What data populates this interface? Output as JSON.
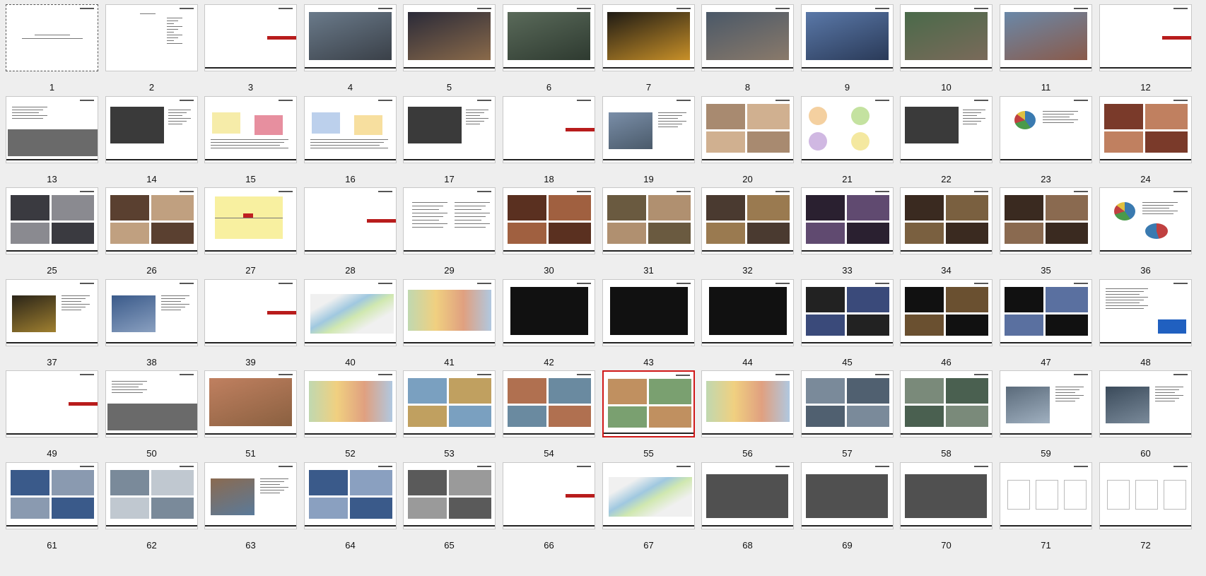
{
  "window": {
    "title": ""
  },
  "colors": {
    "background": "#eeeeee",
    "selection": "#d01818",
    "accent_red": "#b81c1c"
  },
  "selected_slide": 55,
  "slides": [
    {
      "n": "1",
      "kind": "title"
    },
    {
      "n": "2",
      "kind": "toc"
    },
    {
      "n": "3",
      "kind": "section"
    },
    {
      "n": "4",
      "kind": "photo",
      "colors": [
        "#6a7a8a",
        "#3a4048"
      ]
    },
    {
      "n": "5",
      "kind": "photo",
      "colors": [
        "#2a2a38",
        "#8a6a4a"
      ]
    },
    {
      "n": "6",
      "kind": "photo",
      "colors": [
        "#5a6a5a",
        "#2e3a30"
      ]
    },
    {
      "n": "7",
      "kind": "photo",
      "colors": [
        "#1e1a14",
        "#c89028"
      ]
    },
    {
      "n": "8",
      "kind": "photo",
      "colors": [
        "#4a5868",
        "#8a7a6a"
      ]
    },
    {
      "n": "9",
      "kind": "photo",
      "colors": [
        "#5a78a8",
        "#2a3a58"
      ]
    },
    {
      "n": "10",
      "kind": "photo",
      "colors": [
        "#4a6a4a",
        "#7a6a5a"
      ]
    },
    {
      "n": "11",
      "kind": "photo",
      "colors": [
        "#6a88a8",
        "#8a5a4a"
      ]
    },
    {
      "n": "12",
      "kind": "section"
    },
    {
      "n": "13",
      "kind": "map"
    },
    {
      "n": "14",
      "kind": "darkmap"
    },
    {
      "n": "15",
      "kind": "diagram",
      "colors": [
        "#d02040",
        "#f0e070"
      ]
    },
    {
      "n": "16",
      "kind": "diagram",
      "colors": [
        "#f0c040",
        "#90b0e0"
      ]
    },
    {
      "n": "17",
      "kind": "darkmap"
    },
    {
      "n": "18",
      "kind": "section"
    },
    {
      "n": "19",
      "kind": "photo-text",
      "colors": [
        "#7a8ea8",
        "#4a5a6a"
      ]
    },
    {
      "n": "20",
      "kind": "collage",
      "colors": [
        "#a88a70",
        "#d0b090"
      ]
    },
    {
      "n": "21",
      "kind": "circles"
    },
    {
      "n": "22",
      "kind": "darkmap"
    },
    {
      "n": "23",
      "kind": "pie"
    },
    {
      "n": "24",
      "kind": "collage",
      "colors": [
        "#7a3a2a",
        "#c08060"
      ]
    },
    {
      "n": "25",
      "kind": "collage",
      "colors": [
        "#3a3a40",
        "#8a8a90"
      ]
    },
    {
      "n": "26",
      "kind": "collage",
      "colors": [
        "#5a4030",
        "#c0a080"
      ]
    },
    {
      "n": "27",
      "kind": "quadrant"
    },
    {
      "n": "28",
      "kind": "section"
    },
    {
      "n": "29",
      "kind": "text"
    },
    {
      "n": "30",
      "kind": "collage",
      "colors": [
        "#5a3020",
        "#a06040"
      ]
    },
    {
      "n": "31",
      "kind": "collage",
      "colors": [
        "#6a5a40",
        "#b09070"
      ]
    },
    {
      "n": "32",
      "kind": "collage",
      "colors": [
        "#4a3a30",
        "#9a7a50"
      ]
    },
    {
      "n": "33",
      "kind": "collage",
      "colors": [
        "#2a2030",
        "#604a70"
      ]
    },
    {
      "n": "34",
      "kind": "collage",
      "colors": [
        "#3a2a20",
        "#7a6040"
      ]
    },
    {
      "n": "35",
      "kind": "collage",
      "colors": [
        "#3a2a20",
        "#8a6a50"
      ]
    },
    {
      "n": "36",
      "kind": "pie2"
    },
    {
      "n": "37",
      "kind": "photo-text",
      "colors": [
        "#2a2418",
        "#a08030"
      ]
    },
    {
      "n": "38",
      "kind": "photo-text",
      "colors": [
        "#3a5a8a",
        "#8aa0c0"
      ]
    },
    {
      "n": "39",
      "kind": "section"
    },
    {
      "n": "40",
      "kind": "river"
    },
    {
      "n": "41",
      "kind": "plan"
    },
    {
      "n": "42",
      "kind": "blackplan"
    },
    {
      "n": "43",
      "kind": "blackplan"
    },
    {
      "n": "44",
      "kind": "blackplan"
    },
    {
      "n": "45",
      "kind": "collage",
      "colors": [
        "#222",
        "#3a4a7a"
      ]
    },
    {
      "n": "46",
      "kind": "collage",
      "colors": [
        "#111",
        "#6a5030"
      ]
    },
    {
      "n": "47",
      "kind": "collage",
      "colors": [
        "#111",
        "#5a70a0"
      ]
    },
    {
      "n": "48",
      "kind": "logos"
    },
    {
      "n": "49",
      "kind": "section"
    },
    {
      "n": "50",
      "kind": "map",
      "colors": [
        "#e0d070",
        "#90b0d0"
      ]
    },
    {
      "n": "51",
      "kind": "photo",
      "colors": [
        "#c08060",
        "#8a6040"
      ]
    },
    {
      "n": "52",
      "kind": "plan"
    },
    {
      "n": "53",
      "kind": "collage",
      "colors": [
        "#7aa0c0",
        "#c0a060"
      ]
    },
    {
      "n": "54",
      "kind": "collage",
      "colors": [
        "#b07050",
        "#6a8aa0"
      ]
    },
    {
      "n": "55",
      "kind": "collage",
      "colors": [
        "#c09060",
        "#7aa070"
      ]
    },
    {
      "n": "56",
      "kind": "plan"
    },
    {
      "n": "57",
      "kind": "collage",
      "colors": [
        "#7a8a9a",
        "#506070"
      ]
    },
    {
      "n": "58",
      "kind": "collage",
      "colors": [
        "#7a8a7a",
        "#4a6050"
      ]
    },
    {
      "n": "59",
      "kind": "photo-text",
      "colors": [
        "#5a6a7a",
        "#a0b0c0"
      ]
    },
    {
      "n": "60",
      "kind": "photo-text",
      "colors": [
        "#3a4a5a",
        "#7a8a9a"
      ]
    },
    {
      "n": "61",
      "kind": "collage",
      "colors": [
        "#3a5a8a",
        "#8a9ab0"
      ]
    },
    {
      "n": "62",
      "kind": "collage",
      "colors": [
        "#7a8a9a",
        "#c0c8d0"
      ]
    },
    {
      "n": "63",
      "kind": "photo-text",
      "colors": [
        "#8a6a50",
        "#5a7a9a"
      ]
    },
    {
      "n": "64",
      "kind": "collage",
      "colors": [
        "#3a5a8a",
        "#8aa0c0"
      ]
    },
    {
      "n": "65",
      "kind": "collage",
      "colors": [
        "#5a5a5a",
        "#9a9a9a"
      ]
    },
    {
      "n": "66",
      "kind": "section"
    },
    {
      "n": "67",
      "kind": "siteplan"
    },
    {
      "n": "68",
      "kind": "aerialplan"
    },
    {
      "n": "69",
      "kind": "aerialplan"
    },
    {
      "n": "70",
      "kind": "aerialplan"
    },
    {
      "n": "71",
      "kind": "sketch"
    },
    {
      "n": "72",
      "kind": "sketch"
    }
  ]
}
